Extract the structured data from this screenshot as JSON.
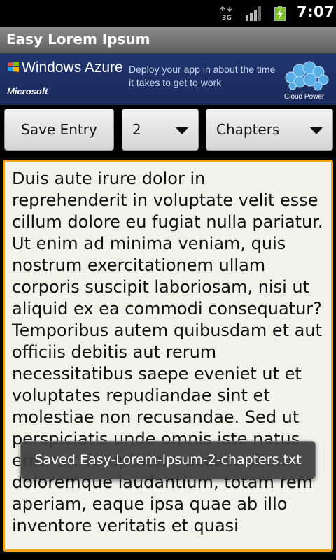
{
  "status_bar": {
    "network_type": "3G",
    "time": "7:07",
    "icons": [
      "3g-data-icon",
      "signal-strength-icon",
      "battery-charging-icon"
    ]
  },
  "app": {
    "title": "Easy Lorem Ipsum"
  },
  "ad_banner": {
    "brand": "Windows Azure",
    "company": "Microsoft",
    "copy": "Deploy your app in about the time it takes to get to work",
    "tagline": "Cloud Power"
  },
  "controls": {
    "save_label": "Save Entry",
    "count_value": "2",
    "unit_value": "Chapters"
  },
  "editor": {
    "text": "Duis aute irure dolor in reprehenderit in voluptate velit esse cillum dolore eu fugiat nulla pariatur.  Ut enim ad minima veniam, quis nostrum exercitationem ullam corporis suscipit laboriosam, nisi ut aliquid ex ea commodi consequatur? Temporibus autem quibusdam et aut officiis debitis aut rerum necessitatibus saepe eveniet ut et voluptates repudiandae sint et molestiae non recusandae.  Sed ut perspiciatis unde omnis iste natus error sit voluptatem accusantium doloremque laudantium, totam rem aperiam, eaque ipsa quae ab illo inventore veritatis et quasi"
  },
  "toast": {
    "message": "Saved Easy-Lorem-Ipsum-2-chapters.txt"
  },
  "colors": {
    "focus_border": "#f6a21a",
    "ad_background": "#22356e",
    "editor_background": "#f2f2ea"
  }
}
